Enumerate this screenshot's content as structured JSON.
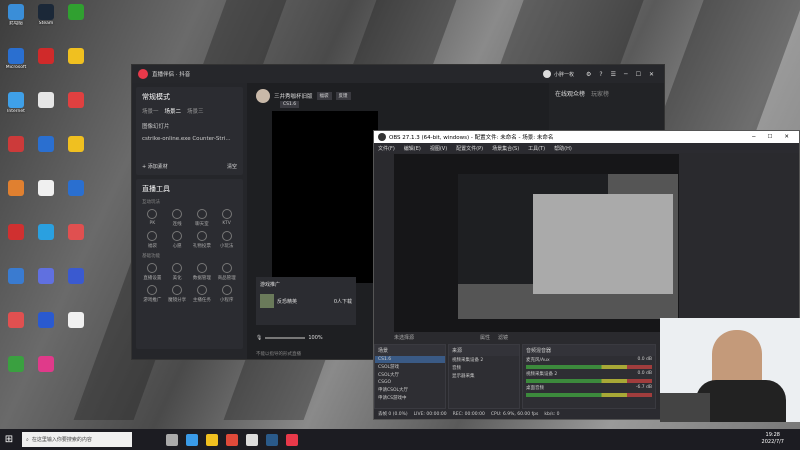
{
  "desktop": {
    "icons_col1": [
      {
        "label": "此电脑",
        "color": "#3a8ed8",
        "icon": "computer-icon"
      },
      {
        "label": "Microsoft",
        "color": "#2a6fd0",
        "icon": "app-icon"
      },
      {
        "label": "Internet",
        "color": "#3fa0e8",
        "icon": "browser-icon"
      },
      {
        "label": "",
        "color": "#cc3a3a",
        "icon": "app-icon"
      },
      {
        "label": "",
        "color": "#e08030",
        "icon": "app-icon"
      },
      {
        "label": "",
        "color": "#d03030",
        "icon": "app-icon"
      },
      {
        "label": "",
        "color": "#3a7bd0",
        "icon": "app-icon"
      },
      {
        "label": "",
        "color": "#e05050",
        "icon": "app-icon"
      },
      {
        "label": "",
        "color": "#3aa040",
        "icon": "app-icon"
      }
    ],
    "icons_col2": [
      {
        "label": "Steam",
        "color": "#1b2838",
        "icon": "steam-icon"
      },
      {
        "label": "",
        "color": "#d02a2a",
        "icon": "app-icon"
      },
      {
        "label": "",
        "color": "#e6e6e6",
        "icon": "file-icon"
      },
      {
        "label": "",
        "color": "#2a6fd0",
        "icon": "app-icon"
      },
      {
        "label": "",
        "color": "#f0f0f0",
        "icon": "file-icon"
      },
      {
        "label": "",
        "color": "#2aa0e0",
        "icon": "app-icon"
      },
      {
        "label": "",
        "color": "#6070e0",
        "icon": "app-icon"
      },
      {
        "label": "",
        "color": "#2a5ad0",
        "icon": "app-icon"
      },
      {
        "label": "",
        "color": "#e03a8a",
        "icon": "app-icon"
      }
    ],
    "icons_col3": [
      {
        "label": "",
        "color": "#30a030",
        "icon": "app-icon"
      },
      {
        "label": "",
        "color": "#f0c020",
        "icon": "folder-icon"
      },
      {
        "label": "",
        "color": "#e04040",
        "icon": "app-icon"
      },
      {
        "label": "",
        "color": "#f0c020",
        "icon": "folder-icon"
      },
      {
        "label": "",
        "color": "#2a6fd0",
        "icon": "app-icon"
      },
      {
        "label": "",
        "color": "#e05050",
        "icon": "app-icon"
      },
      {
        "label": "",
        "color": "#3a5ad0",
        "icon": "app-icon"
      },
      {
        "label": "",
        "color": "#f0f0f0",
        "icon": "file-icon"
      }
    ]
  },
  "live_window": {
    "app_title": "直播伴侣 · 抖音",
    "user_name": "小胖一枚",
    "mode_title": "常规模式",
    "scene_tabs": [
      "场景一",
      "场景二",
      "场景三"
    ],
    "sources": [
      "图像幻灯片",
      "cstrike-online.exe Counter-Stri..."
    ],
    "add_source": "+ 添加素材",
    "clear_label": "清空",
    "tools_title": "直播工具",
    "tools_row_label": "互动玩法",
    "tools": [
      "PK",
      "连线",
      "聊天室",
      "KTV",
      "福袋",
      "心愿",
      "礼物投票",
      "小玩法"
    ],
    "tools2_label": "基础功能",
    "tools2": [
      "直播设置",
      "美化",
      "数据管理",
      "商品管理",
      "游戏推广",
      "魔镜分享",
      "主播任务",
      "小程序"
    ],
    "streamer_name": "三井秀咖杯旧版",
    "streamer_tags": [
      "福袋",
      "反馈"
    ],
    "game_chip": "CS1.6",
    "promo_title": "游戏推广",
    "promo_game": "反恐精英",
    "promo_count": "0人下载",
    "volume": "100%",
    "volume_hint": "不能以指导的形式直播",
    "right_panel_title": "在线观众榜",
    "right_panel_tab": "玩家榜"
  },
  "obs": {
    "title": "OBS 27.1.3 (64-bit, windows) - 配置文件: 未命名 - 场景: 未命名",
    "menu": [
      "文件(F)",
      "编辑(E)",
      "视图(V)",
      "配置文件(P)",
      "场景集合(S)",
      "工具(T)",
      "帮助(H)"
    ],
    "scene_label": "未选择源",
    "scenes_header": "场景",
    "scenes": [
      "CS1.6",
      "CSOL游戏",
      "CSOL大厅",
      "CSGO",
      "申请CSOL大厅",
      "申请CS游戏中"
    ],
    "sources_header": "来源",
    "sources": [
      "视频采集设备 2",
      "音频",
      "显示器采集"
    ],
    "mixer_header": "音频混音器",
    "mixer": [
      {
        "name": "麦克风/Aux",
        "db": "0.0 dB"
      },
      {
        "name": "视频采集设备 2",
        "db": "0.0 dB"
      },
      {
        "name": "桌面音频",
        "db": "-6.7 dB"
      }
    ],
    "properties": "属性",
    "filters": "滤镜",
    "status": [
      "丢帧 0 (0.0%)",
      "LIVE: 00:00:00",
      "REC: 00:00:00",
      "CPU: 6.9%, 60.00 fps",
      "kb/s: 0"
    ]
  },
  "taskbar": {
    "search_placeholder": "在这里输入你要搜索的内容",
    "time": "19:28",
    "date": "2022/7/7",
    "apps": [
      {
        "name": "task-view-icon",
        "color": "#aaa"
      },
      {
        "name": "edge-icon",
        "color": "#3a9be8"
      },
      {
        "name": "folder-icon",
        "color": "#f0c020"
      },
      {
        "name": "chrome-icon",
        "color": "#e04a3a"
      },
      {
        "name": "obs-icon",
        "color": "#ddd"
      },
      {
        "name": "steam-icon",
        "color": "#2a5a8a"
      },
      {
        "name": "tiktok-icon",
        "color": "#e8394a"
      }
    ]
  }
}
